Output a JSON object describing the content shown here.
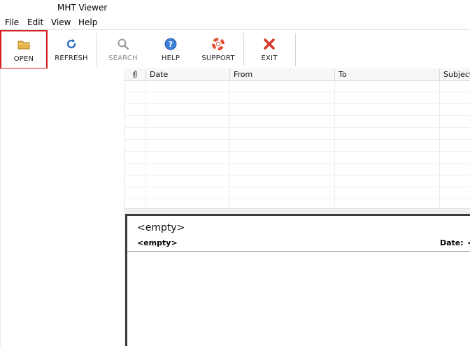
{
  "window": {
    "title": "MHT Viewer"
  },
  "menu": [
    "File",
    "Edit",
    "View",
    "Help"
  ],
  "toolbar": {
    "open": "OPEN",
    "refresh": "REFRESH",
    "search": "SEARCH",
    "help": "HELP",
    "support": "SUPPORT",
    "exit": "EXIT"
  },
  "grid": {
    "columns": [
      "Date",
      "From",
      "To",
      "Subject"
    ]
  },
  "preview": {
    "subject": "<empty>",
    "from": "<empty>",
    "date_label": "Date:",
    "date_value": "<"
  },
  "colors": {
    "selection_border": "#d61f1f",
    "refresh_icon": "#2f6fc0",
    "exit_icon": "#d33b2c",
    "folder_icon": "#e6b34a"
  }
}
